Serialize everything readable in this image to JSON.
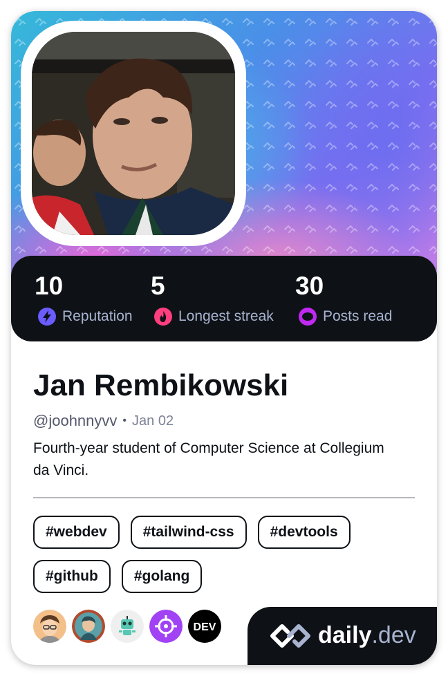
{
  "profile": {
    "name": "Jan Rembikowski",
    "handle": "@joohnnyvv",
    "joined": "Jan 02",
    "bio": "Fourth-year student of Computer Science at Collegium da Vinci."
  },
  "stats": [
    {
      "value": "10",
      "label": "Reputation",
      "icon": "lightning-icon",
      "color": "#6a5cff"
    },
    {
      "value": "5",
      "label": "Longest streak",
      "icon": "flame-icon",
      "color": "#ff3e7f"
    },
    {
      "value": "30",
      "label": "Posts read",
      "icon": "eye-ring-icon",
      "color": "#c029f0"
    }
  ],
  "tags": [
    "#webdev",
    "#tailwind-css",
    "#devtools",
    "#github",
    "#golang"
  ],
  "sources": [
    {
      "name": "developer-avatar-source",
      "kind": "avatar"
    },
    {
      "name": "illustrated-avatar-source",
      "kind": "avatar"
    },
    {
      "name": "robot-avatar-source",
      "kind": "avatar"
    },
    {
      "name": "crosshair-source",
      "kind": "icon",
      "color": "#a142f4"
    },
    {
      "name": "dev-to-source",
      "kind": "text",
      "text": "DEV"
    }
  ],
  "brand": {
    "bold": "daily",
    "suffix": ".dev"
  },
  "colors": {
    "dark": "#0e1217",
    "muted": "#a8b3cf"
  }
}
